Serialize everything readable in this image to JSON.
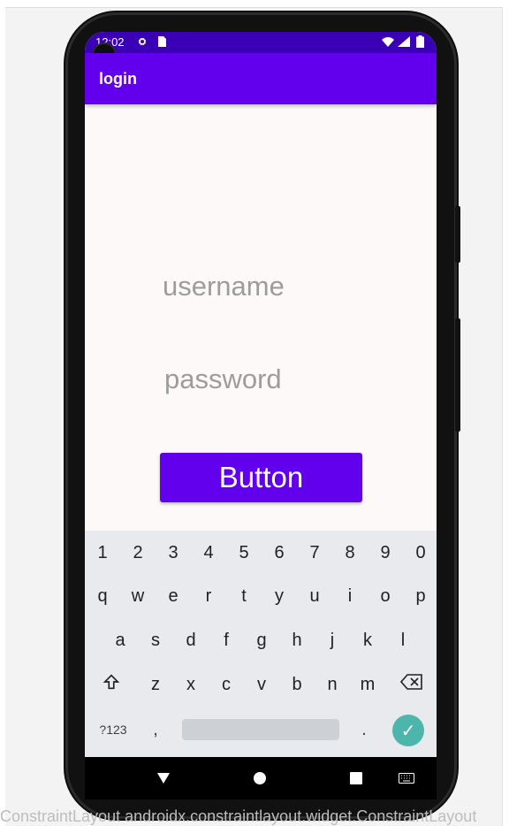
{
  "status_bar": {
    "time": "12:02",
    "icons": [
      "gear-icon",
      "sim-card-icon",
      "wifi-icon",
      "signal-icon",
      "battery-icon"
    ]
  },
  "app_bar": {
    "title": "login"
  },
  "form": {
    "username_placeholder": "username",
    "password_placeholder": "password",
    "button_label": "Button"
  },
  "keyboard": {
    "number_row": [
      "1",
      "2",
      "3",
      "4",
      "5",
      "6",
      "7",
      "8",
      "9",
      "0"
    ],
    "row1": [
      "q",
      "w",
      "e",
      "r",
      "t",
      "y",
      "u",
      "i",
      "o",
      "p"
    ],
    "row2": [
      "a",
      "s",
      "d",
      "f",
      "g",
      "h",
      "j",
      "k",
      "l"
    ],
    "row3": [
      "z",
      "x",
      "c",
      "v",
      "b",
      "n",
      "m"
    ],
    "mode_key": "?123",
    "comma_key": ",",
    "period_key": "."
  },
  "colors": {
    "app_bar": "#6200ee",
    "status_bar": "#3a00b5",
    "button": "#6200ee",
    "enter_key": "#4db6ac"
  },
  "bottom_text": "ConstraintLayout androidx.constraintlayout.widget.ConstraintLayout"
}
